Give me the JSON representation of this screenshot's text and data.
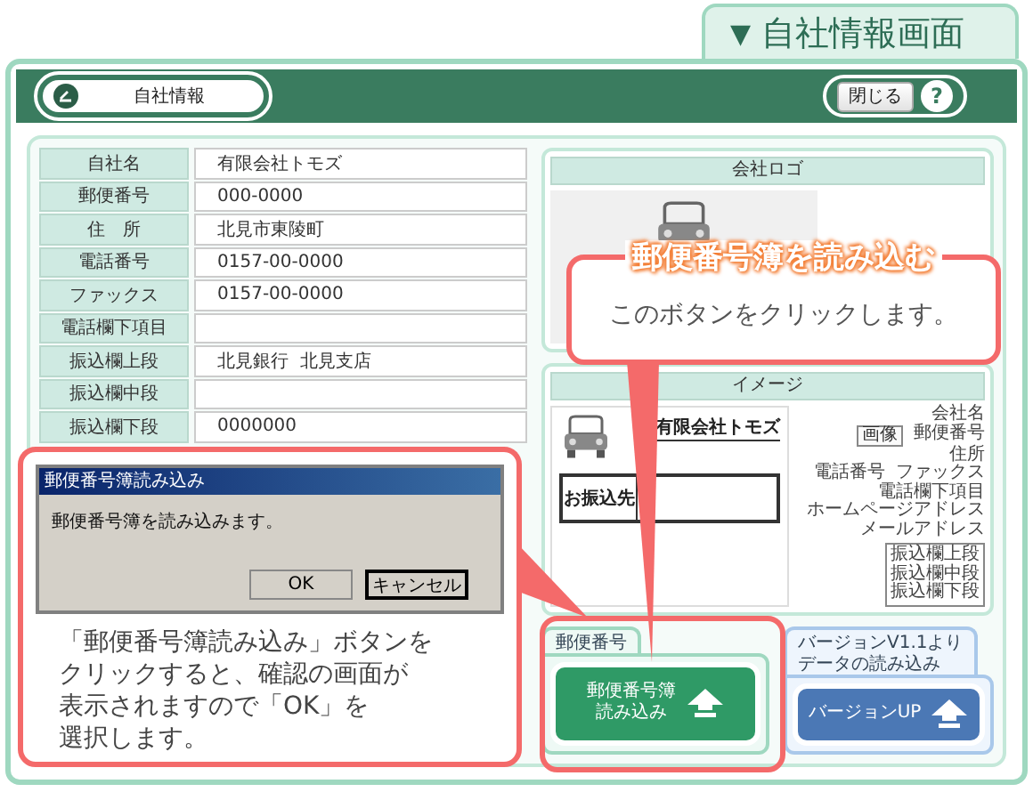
{
  "screen_tab": {
    "marker": "▼",
    "label": "自社情報画面"
  },
  "header": {
    "title": "自社情報",
    "close_button": "閉じる",
    "help_button": "?"
  },
  "fields": [
    {
      "label": "自社名",
      "value": "有限会社トモズ"
    },
    {
      "label": "郵便番号",
      "value": "000-0000"
    },
    {
      "label": "住　所",
      "value": "北見市東陵町"
    },
    {
      "label": "電話番号",
      "value": "0157-00-0000"
    },
    {
      "label": "ファックス",
      "value": "0157-00-0000"
    },
    {
      "label": "電話欄下項目"
    },
    {
      "label": "振込欄上段",
      "value": "北見銀行  北見支店"
    },
    {
      "label": "振込欄中段"
    },
    {
      "label": "振込欄下段",
      "value": "0000000"
    }
  ],
  "logo_panel": {
    "title": "会社ロゴ"
  },
  "image_panel": {
    "title": "イメージ",
    "preview": {
      "company": "有限会社トモズ",
      "transfer_label": "お振込先"
    },
    "legend": [
      {
        "kind": "text",
        "items": [
          "会社名"
        ]
      },
      {
        "kind": "button_text",
        "items": [
          "画像",
          "郵便番号"
        ]
      },
      {
        "kind": "text",
        "items": [
          "住所"
        ]
      },
      {
        "kind": "text",
        "items": [
          "電話番号",
          "ファックス"
        ]
      },
      {
        "kind": "text",
        "items": [
          "電話欄下項目"
        ]
      },
      {
        "kind": "text",
        "items": [
          "ホームページアドレス"
        ]
      },
      {
        "kind": "text",
        "items": [
          "メールアドレス"
        ]
      },
      {
        "kind": "box",
        "items": [
          "振込欄上段",
          "振込欄中段",
          "振込欄下段"
        ]
      }
    ]
  },
  "postal_group": {
    "title": "郵便番号",
    "button_lines": [
      "郵便番号簿",
      "読み込み"
    ]
  },
  "version_group": {
    "title_lines": [
      "バージョンV1.1より",
      "データの読み込み"
    ],
    "button": "バージョンUP"
  },
  "button_callout": {
    "title": "郵便番号簿を読み込む",
    "text": "このボタンをクリックします。"
  },
  "dialog_callout": {
    "dialog": {
      "title": "郵便番号簿読み込み",
      "message": "郵便番号簿を読み込みます。",
      "buttons": [
        {
          "label": "OK",
          "focused": false
        },
        {
          "label": "キャンセル",
          "focused": true
        }
      ]
    },
    "text_lines": [
      "「郵便番号簿読み込み」ボタンを",
      "クリックすると、確認の画面が",
      "表示されますので「OK」を",
      "選択します。"
    ]
  }
}
